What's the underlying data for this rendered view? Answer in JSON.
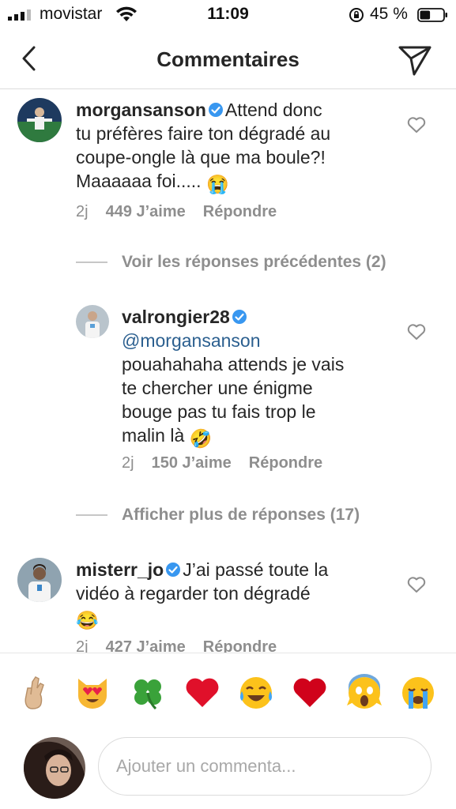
{
  "status_bar": {
    "carrier": "movistar",
    "time": "11:09",
    "battery": "45 %",
    "battery_level": 0.45
  },
  "header": {
    "title": "Commentaires",
    "back_icon": "chevron-left-icon",
    "send_icon": "paper-plane-icon"
  },
  "comments": [
    {
      "username": "morgansanson",
      "verified": true,
      "lines": [
        "Attend donc",
        "tu préfères faire ton dégradé au",
        "coupe-ongle là que ma boule?!",
        "Maaaaaa foi....."
      ],
      "emoji": "😭",
      "age": "2j",
      "likes": "449 J’aime",
      "reply": "Répondre"
    },
    {
      "username": "valrongier28",
      "verified": true,
      "mention": "@morgansanson",
      "lines": [
        "pouahahaha attends je vais",
        "te chercher une énigme",
        "bouge pas tu fais trop le",
        "malin là"
      ],
      "emoji": "🤣",
      "age": "2j",
      "likes": "150 J’aime",
      "reply": "Répondre"
    },
    {
      "username": "misterr_jo",
      "verified": true,
      "lines": [
        "J’ai passé toute la",
        "vidéo à regarder ton dégradé"
      ],
      "emoji": "😂",
      "age": "2j",
      "likes": "427 J’aime",
      "reply": "Répondre"
    }
  ],
  "threads": {
    "previous_replies": "Voir les réponses précédentes (2)",
    "more_replies": "Afficher plus de réponses (17)"
  },
  "emoji_bar": [
    "🤞",
    "😻",
    "🍀",
    "❤️",
    "😂",
    "❤️",
    "😱",
    "😭"
  ],
  "composer": {
    "placeholder": "Ajouter un commenta..."
  }
}
